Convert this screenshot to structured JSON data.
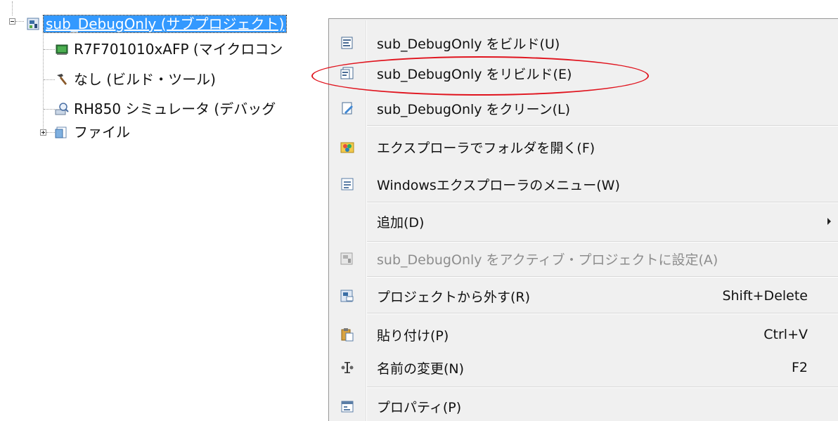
{
  "tree": {
    "root": {
      "label": "sub_DebugOnly (サブプロジェクト)",
      "icon": "subproject-icon",
      "expanded": true,
      "selected": true
    },
    "children": [
      {
        "label": "R7F701010xAFP (マイクロコン",
        "icon": "microcontroller-icon"
      },
      {
        "label": "なし (ビルド・ツール)",
        "icon": "hammer-icon"
      },
      {
        "label": "RH850 シミュレータ (デバッグ",
        "icon": "debug-tool-icon"
      },
      {
        "label": "ファイル",
        "icon": "folder-icon",
        "collapsed": true
      }
    ]
  },
  "context_menu": {
    "items": [
      {
        "label": "sub_DebugOnly をビルド(U)",
        "icon": "build-icon",
        "shortcut": "",
        "enabled": true
      },
      {
        "label": "sub_DebugOnly をリビルド(E)",
        "icon": "rebuild-icon",
        "shortcut": "",
        "enabled": true,
        "highlighted_by_annotation": true
      },
      {
        "label": "sub_DebugOnly をクリーン(L)",
        "icon": "clean-icon",
        "shortcut": "",
        "enabled": true
      },
      {
        "label": "エクスプローラでフォルダを開く(F)",
        "icon": "explorer-folder-icon",
        "shortcut": "",
        "enabled": true
      },
      {
        "label": "Windowsエクスプローラのメニュー(W)",
        "icon": "windows-menu-icon",
        "shortcut": "",
        "enabled": true
      },
      {
        "label": "追加(D)",
        "icon": "",
        "shortcut": "",
        "enabled": true,
        "has_submenu": true
      },
      {
        "label": "sub_DebugOnly をアクティブ・プロジェクトに設定(A)",
        "icon": "active-project-icon",
        "shortcut": "",
        "enabled": false
      },
      {
        "label": "プロジェクトから外す(R)",
        "icon": "remove-project-icon",
        "shortcut": "Shift+Delete",
        "enabled": true
      },
      {
        "label": "貼り付け(P)",
        "icon": "paste-icon",
        "shortcut": "Ctrl+V",
        "enabled": true
      },
      {
        "label": "名前の変更(N)",
        "icon": "rename-icon",
        "shortcut": "F2",
        "enabled": true
      },
      {
        "label": "プロパティ(P)",
        "icon": "properties-icon",
        "shortcut": "",
        "enabled": true
      }
    ]
  },
  "annotation": {
    "target": "sub_DebugOnly をリビルド(E)",
    "color": "#e0141e"
  },
  "colors": {
    "selection": "#3399ff",
    "menu_background": "#f0f0f0",
    "disabled_text": "#8d8d8d"
  }
}
